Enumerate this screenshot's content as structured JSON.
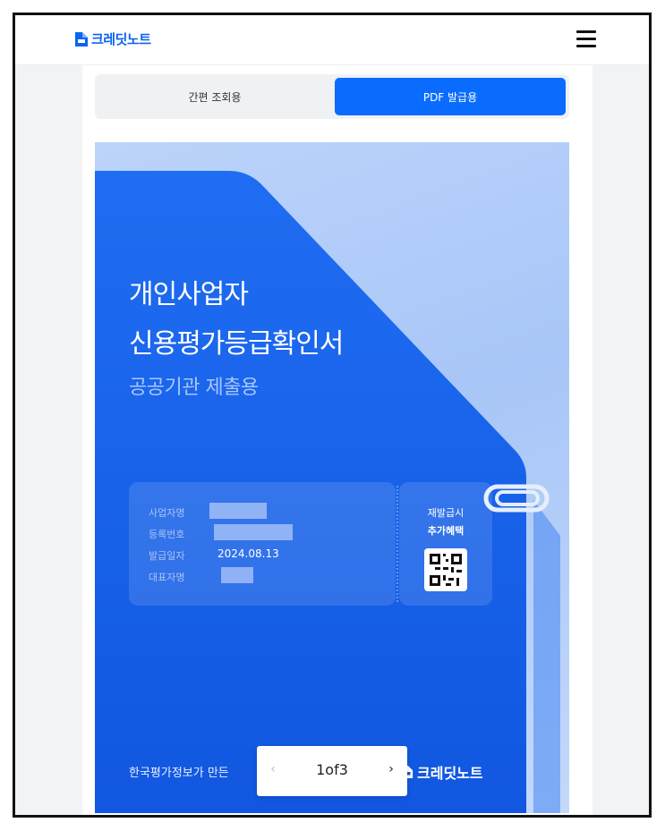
{
  "brand": {
    "name": "크레딧노트",
    "accent": "#0a6cff"
  },
  "header": {
    "menu_icon": "hamburger-icon"
  },
  "tabs": [
    {
      "label": "간편 조회용",
      "active": false
    },
    {
      "label": "PDF 발급용",
      "active": true
    }
  ],
  "document": {
    "title_line1": "개인사업자",
    "title_line2": "신용평가등급확인서",
    "subtitle": "공공기관 제출용",
    "fields": [
      {
        "label": "사업자명",
        "value": ""
      },
      {
        "label": "등록번호",
        "value": ""
      },
      {
        "label": "발급일자",
        "value": "2024.08.13"
      },
      {
        "label": "대표자명",
        "value": ""
      }
    ],
    "side_line1": "재발급시",
    "side_line2": "추가혜택",
    "footer_text": "한국평가정보가 만든 ",
    "footer_brand": "크레딧노트"
  },
  "pager": {
    "prev": "‹",
    "next": "›",
    "count": "1of3"
  }
}
